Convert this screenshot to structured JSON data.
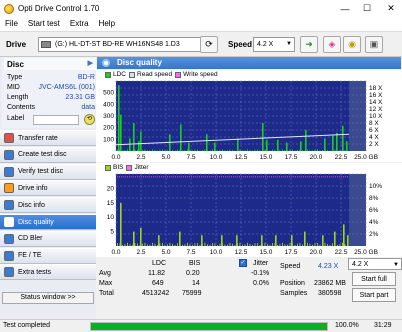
{
  "window": {
    "title": "Opti Drive Control 1.70",
    "minimize": "—",
    "maximize": "☐",
    "close": "✕"
  },
  "menu": [
    "File",
    "Start test",
    "Extra",
    "Help"
  ],
  "toolbar": {
    "drive_label": "Drive",
    "drive_value": "(G:)  HL-DT-ST BD-RE  WH16NS48 1.D3",
    "speed_label": "Speed",
    "speed_value": "4.2 X"
  },
  "disc": {
    "header": "Disc",
    "rows": [
      {
        "key": "Type",
        "value": "BD-R"
      },
      {
        "key": "MID",
        "value": "JVC-AMS6L (001)"
      },
      {
        "key": "Length",
        "value": "23.31 GB"
      },
      {
        "key": "Contents",
        "value": "data"
      },
      {
        "key": "Label",
        "value": ""
      }
    ]
  },
  "nav": [
    {
      "label": "Transfer rate",
      "icon": "transfer-rate-icon",
      "color": "#d9534f"
    },
    {
      "label": "Create test disc",
      "icon": "create-disc-icon",
      "color": "#3c7bd4"
    },
    {
      "label": "Verify test disc",
      "icon": "verify-disc-icon",
      "color": "#3c7bd4"
    },
    {
      "label": "Drive info",
      "icon": "drive-info-icon",
      "color": "#ff9c1a"
    },
    {
      "label": "Disc info",
      "icon": "disc-info-icon",
      "color": "#3c7bd4"
    },
    {
      "label": "Disc quality",
      "icon": "disc-quality-icon",
      "color": "#ffffff",
      "active": true
    },
    {
      "label": "CD Bler",
      "icon": "cd-bler-icon",
      "color": "#3c7bd4"
    },
    {
      "label": "FE / TE",
      "icon": "fe-te-icon",
      "color": "#3c7bd4"
    },
    {
      "label": "Extra tests",
      "icon": "extra-tests-icon",
      "color": "#3c7bd4"
    }
  ],
  "status_window_label": "Status window >>",
  "panel_title": "Disc quality",
  "chart_data": [
    {
      "type": "bar",
      "legend": [
        "LDC",
        "Read speed",
        "Write speed"
      ],
      "colors": {
        "LDC": "#14d214",
        "Read speed": "#cfe3f7",
        "Write speed": "#ff66ff"
      },
      "x_ticks": [
        "0.0",
        "2.5",
        "5.0",
        "7.5",
        "10.0",
        "12.5",
        "15.0",
        "17.5",
        "20.0",
        "22.5",
        "25.0 GB"
      ],
      "xlim": [
        0,
        25
      ],
      "y_left_ticks": [
        "500",
        "400",
        "300",
        "200",
        "100"
      ],
      "ylim_left": [
        0,
        500
      ],
      "y_right_ticks": [
        "18 X",
        "16 X",
        "14 X",
        "12 X",
        "10 X",
        "8 X",
        "6 X",
        "4 X",
        "2 X"
      ],
      "ylim_right": [
        0,
        18
      ],
      "data_end_gb": 23.31,
      "read_speed_x": [
        0,
        23.31
      ],
      "read_speed_y": [
        1.6,
        4.3
      ],
      "spikes": [
        [
          0.2,
          470
        ],
        [
          0.4,
          260
        ],
        [
          1.3,
          90
        ],
        [
          1.7,
          200
        ],
        [
          2.2,
          70
        ],
        [
          2.4,
          140
        ],
        [
          5.3,
          120
        ],
        [
          6.4,
          190
        ],
        [
          7.2,
          60
        ],
        [
          9.0,
          120
        ],
        [
          9.8,
          60
        ],
        [
          12.1,
          90
        ],
        [
          14.6,
          200
        ],
        [
          15.0,
          80
        ],
        [
          16.1,
          80
        ],
        [
          17.0,
          60
        ],
        [
          18.4,
          70
        ],
        [
          18.9,
          150
        ],
        [
          20.8,
          90
        ],
        [
          21.6,
          110
        ],
        [
          22.0,
          130
        ],
        [
          22.6,
          180
        ],
        [
          23.0,
          70
        ]
      ]
    },
    {
      "type": "bar",
      "legend": [
        "BIS",
        "Jitter"
      ],
      "colors": {
        "BIS": "#9bd81c",
        "Jitter": "#ff66ff"
      },
      "x_ticks": [
        "0.0",
        "2.5",
        "5.0",
        "7.5",
        "10.0",
        "12.5",
        "15.0",
        "17.5",
        "20.0",
        "22.5",
        "25.0 GB"
      ],
      "xlim": [
        0,
        25
      ],
      "y_left_ticks": [
        "20",
        "15",
        "10",
        "5"
      ],
      "ylim_left": [
        0,
        20
      ],
      "y_right_ticks": [
        "10%",
        "8%",
        "6%",
        "4%",
        "2%"
      ],
      "ylim_right": [
        0,
        10
      ],
      "data_end_gb": 23.31,
      "spikes": [
        [
          0.4,
          12
        ],
        [
          1.7,
          4
        ],
        [
          2.4,
          5
        ],
        [
          4.2,
          3
        ],
        [
          6.3,
          4
        ],
        [
          8.5,
          3
        ],
        [
          10.5,
          3
        ],
        [
          12.0,
          3
        ],
        [
          14.5,
          3
        ],
        [
          15.9,
          3
        ],
        [
          17.5,
          3
        ],
        [
          18.8,
          4
        ],
        [
          20.6,
          3
        ],
        [
          21.8,
          4
        ],
        [
          22.7,
          6
        ],
        [
          23.1,
          3
        ]
      ]
    }
  ],
  "stats": {
    "col_ldc": "LDC",
    "col_bis": "BIS",
    "jitter_label": "Jitter",
    "rows": [
      {
        "label": "Avg",
        "ldc": "11.82",
        "bis": "0.20",
        "jitter": "-0.1%"
      },
      {
        "label": "Max",
        "ldc": "649",
        "bis": "14",
        "jitter": "0.0%"
      },
      {
        "label": "Total",
        "ldc": "4513242",
        "bis": "75999",
        "jitter": ""
      }
    ],
    "speed_label": "Speed",
    "speed_value": "4.23 X",
    "position_label": "Position",
    "position_value": "23862 MB",
    "samples_label": "Samples",
    "samples_value": "380598",
    "speed_select": "4.2 X",
    "start_full": "Start full",
    "start_part": "Start part"
  },
  "statusbar": {
    "text": "Test completed",
    "progress": 100,
    "percent": "100.0%",
    "time": "31:29"
  }
}
